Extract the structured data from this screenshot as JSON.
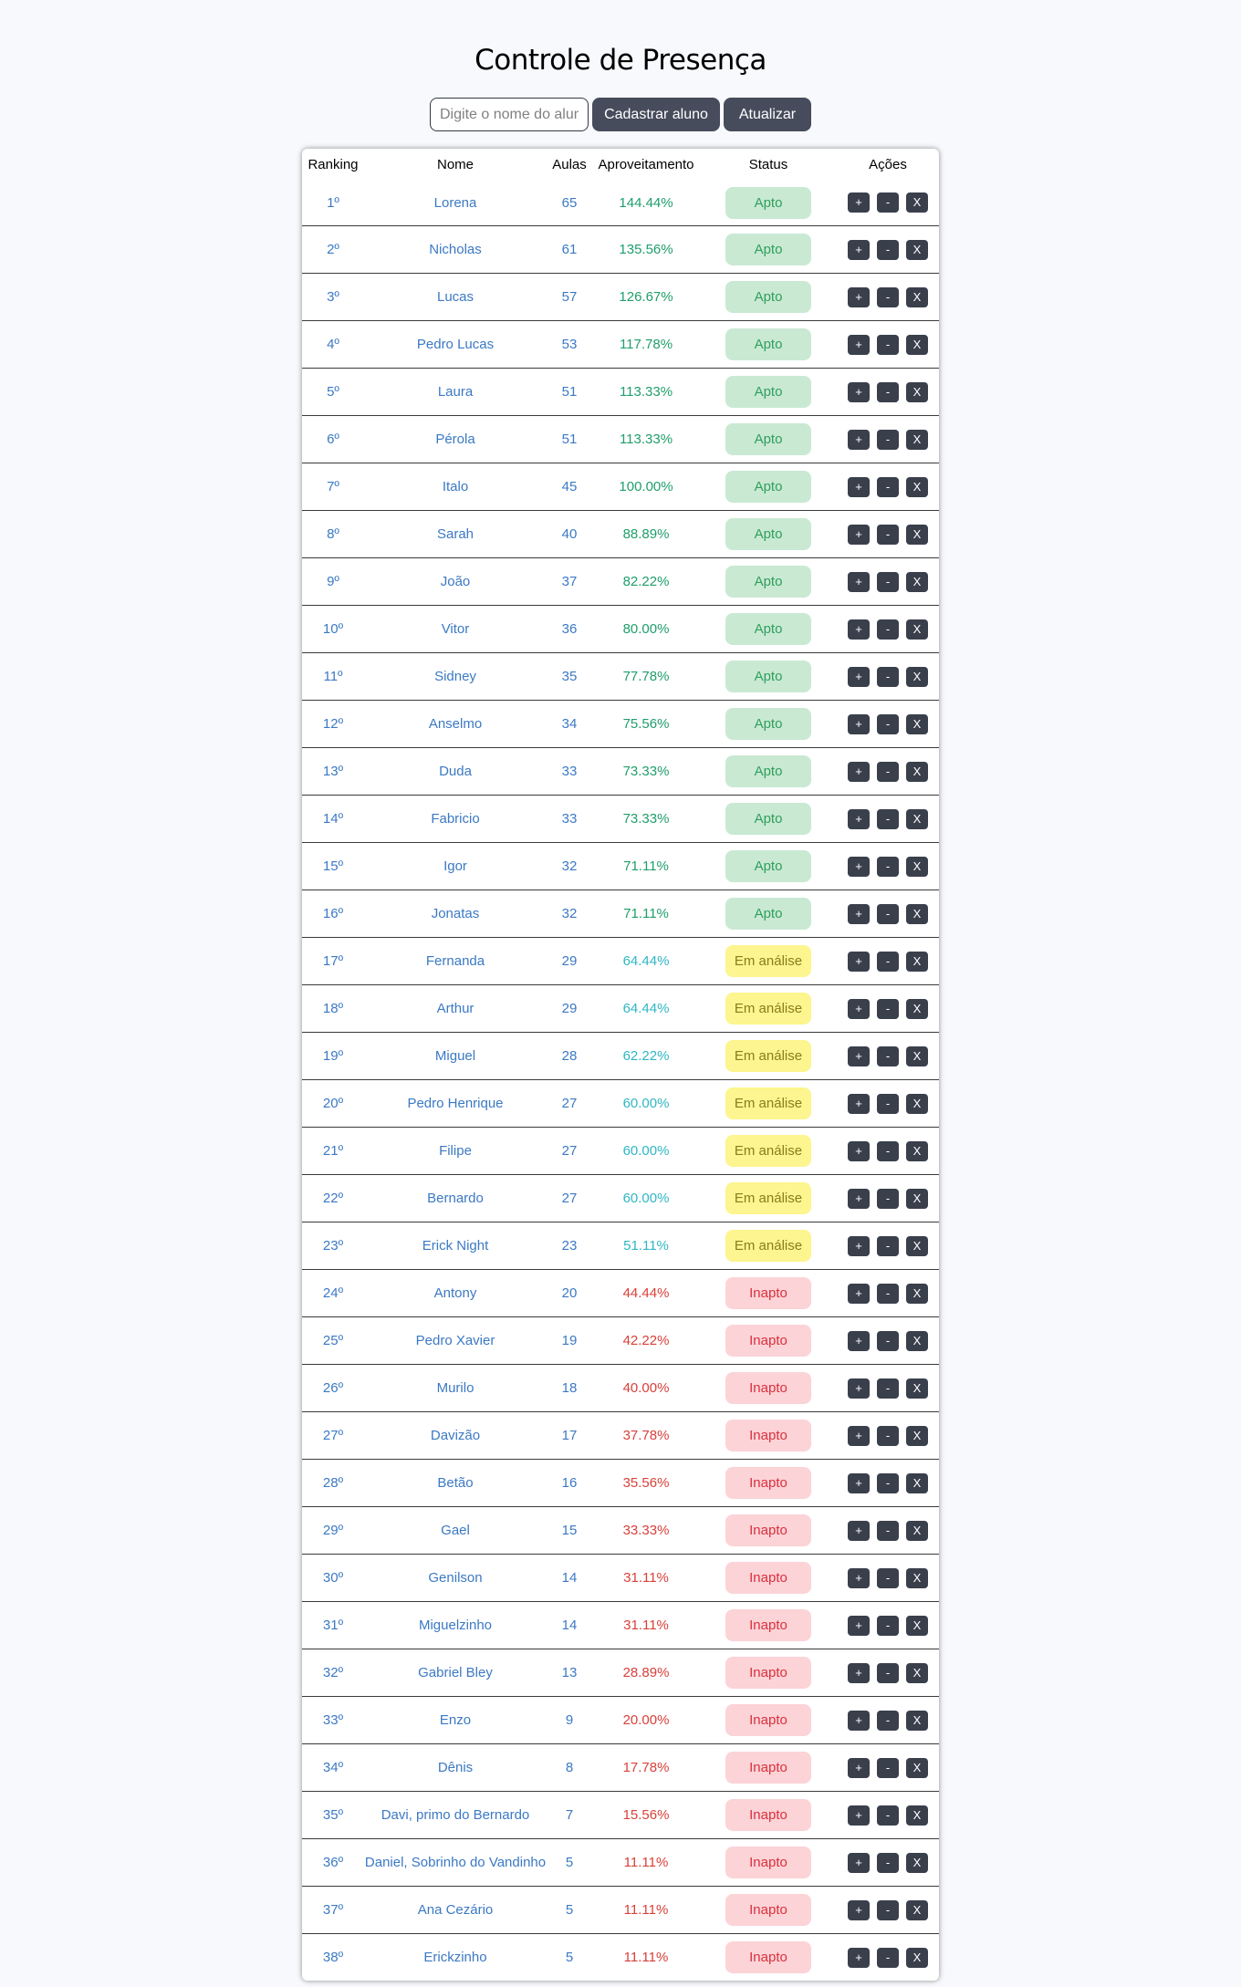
{
  "page": {
    "title": "Controle de Presença"
  },
  "controls": {
    "search_placeholder": "Digite o nome do aluno",
    "register_label": "Cadastrar aluno",
    "refresh_label": "Atualizar"
  },
  "table": {
    "headers": {
      "ranking": "Ranking",
      "nome": "Nome",
      "aulas": "Aulas",
      "aproveitamento": "Aproveitamento",
      "status": "Status",
      "acoes": "Ações"
    },
    "action_labels": {
      "add": "+",
      "remove": "-",
      "delete": "X"
    },
    "colors": {
      "apto": "#2f9f5d",
      "em_analise": "#8a7d1b",
      "inapto": "#d9303d",
      "link": "#3b79c4"
    },
    "rows": [
      {
        "rank": "1º",
        "name": "Lorena",
        "aulas": "65",
        "pct": "144.44%",
        "status": "Apto"
      },
      {
        "rank": "2º",
        "name": "Nicholas",
        "aulas": "61",
        "pct": "135.56%",
        "status": "Apto"
      },
      {
        "rank": "3º",
        "name": "Lucas",
        "aulas": "57",
        "pct": "126.67%",
        "status": "Apto"
      },
      {
        "rank": "4º",
        "name": "Pedro Lucas",
        "aulas": "53",
        "pct": "117.78%",
        "status": "Apto"
      },
      {
        "rank": "5º",
        "name": "Laura",
        "aulas": "51",
        "pct": "113.33%",
        "status": "Apto"
      },
      {
        "rank": "6º",
        "name": "Pérola",
        "aulas": "51",
        "pct": "113.33%",
        "status": "Apto"
      },
      {
        "rank": "7º",
        "name": "Italo",
        "aulas": "45",
        "pct": "100.00%",
        "status": "Apto"
      },
      {
        "rank": "8º",
        "name": "Sarah",
        "aulas": "40",
        "pct": "88.89%",
        "status": "Apto"
      },
      {
        "rank": "9º",
        "name": "João",
        "aulas": "37",
        "pct": "82.22%",
        "status": "Apto"
      },
      {
        "rank": "10º",
        "name": "Vitor",
        "aulas": "36",
        "pct": "80.00%",
        "status": "Apto"
      },
      {
        "rank": "11º",
        "name": "Sidney",
        "aulas": "35",
        "pct": "77.78%",
        "status": "Apto"
      },
      {
        "rank": "12º",
        "name": "Anselmo",
        "aulas": "34",
        "pct": "75.56%",
        "status": "Apto"
      },
      {
        "rank": "13º",
        "name": "Duda",
        "aulas": "33",
        "pct": "73.33%",
        "status": "Apto"
      },
      {
        "rank": "14º",
        "name": "Fabricio",
        "aulas": "33",
        "pct": "73.33%",
        "status": "Apto"
      },
      {
        "rank": "15º",
        "name": "Igor",
        "aulas": "32",
        "pct": "71.11%",
        "status": "Apto"
      },
      {
        "rank": "16º",
        "name": "Jonatas",
        "aulas": "32",
        "pct": "71.11%",
        "status": "Apto"
      },
      {
        "rank": "17º",
        "name": "Fernanda",
        "aulas": "29",
        "pct": "64.44%",
        "status": "Em análise"
      },
      {
        "rank": "18º",
        "name": "Arthur",
        "aulas": "29",
        "pct": "64.44%",
        "status": "Em análise"
      },
      {
        "rank": "19º",
        "name": "Miguel",
        "aulas": "28",
        "pct": "62.22%",
        "status": "Em análise"
      },
      {
        "rank": "20º",
        "name": "Pedro Henrique",
        "aulas": "27",
        "pct": "60.00%",
        "status": "Em análise"
      },
      {
        "rank": "21º",
        "name": "Filipe",
        "aulas": "27",
        "pct": "60.00%",
        "status": "Em análise"
      },
      {
        "rank": "22º",
        "name": "Bernardo",
        "aulas": "27",
        "pct": "60.00%",
        "status": "Em análise"
      },
      {
        "rank": "23º",
        "name": "Erick Night",
        "aulas": "23",
        "pct": "51.11%",
        "status": "Em análise"
      },
      {
        "rank": "24º",
        "name": "Antony",
        "aulas": "20",
        "pct": "44.44%",
        "status": "Inapto"
      },
      {
        "rank": "25º",
        "name": "Pedro Xavier",
        "aulas": "19",
        "pct": "42.22%",
        "status": "Inapto"
      },
      {
        "rank": "26º",
        "name": "Murilo",
        "aulas": "18",
        "pct": "40.00%",
        "status": "Inapto"
      },
      {
        "rank": "27º",
        "name": "Davizão",
        "aulas": "17",
        "pct": "37.78%",
        "status": "Inapto"
      },
      {
        "rank": "28º",
        "name": "Betão",
        "aulas": "16",
        "pct": "35.56%",
        "status": "Inapto"
      },
      {
        "rank": "29º",
        "name": "Gael",
        "aulas": "15",
        "pct": "33.33%",
        "status": "Inapto"
      },
      {
        "rank": "30º",
        "name": "Genilson",
        "aulas": "14",
        "pct": "31.11%",
        "status": "Inapto"
      },
      {
        "rank": "31º",
        "name": "Miguelzinho",
        "aulas": "14",
        "pct": "31.11%",
        "status": "Inapto"
      },
      {
        "rank": "32º",
        "name": "Gabriel Bley",
        "aulas": "13",
        "pct": "28.89%",
        "status": "Inapto"
      },
      {
        "rank": "33º",
        "name": "Enzo",
        "aulas": "9",
        "pct": "20.00%",
        "status": "Inapto"
      },
      {
        "rank": "34º",
        "name": "Dênis",
        "aulas": "8",
        "pct": "17.78%",
        "status": "Inapto"
      },
      {
        "rank": "35º",
        "name": "Davi, primo do Bernardo",
        "aulas": "7",
        "pct": "15.56%",
        "status": "Inapto"
      },
      {
        "rank": "36º",
        "name": "Daniel, Sobrinho do Vandinho",
        "aulas": "5",
        "pct": "11.11%",
        "status": "Inapto"
      },
      {
        "rank": "37º",
        "name": "Ana Cezário",
        "aulas": "5",
        "pct": "11.11%",
        "status": "Inapto"
      },
      {
        "rank": "38º",
        "name": "Erickzinho",
        "aulas": "5",
        "pct": "11.11%",
        "status": "Inapto"
      }
    ]
  }
}
